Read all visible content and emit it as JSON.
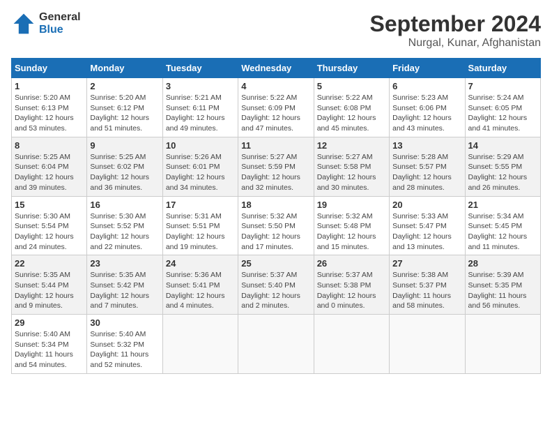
{
  "logo": {
    "line1": "General",
    "line2": "Blue"
  },
  "title": "September 2024",
  "location": "Nurgal, Kunar, Afghanistan",
  "weekdays": [
    "Sunday",
    "Monday",
    "Tuesday",
    "Wednesday",
    "Thursday",
    "Friday",
    "Saturday"
  ],
  "weeks": [
    [
      {
        "day": "1",
        "sunrise": "Sunrise: 5:20 AM",
        "sunset": "Sunset: 6:13 PM",
        "daylight": "Daylight: 12 hours and 53 minutes."
      },
      {
        "day": "2",
        "sunrise": "Sunrise: 5:20 AM",
        "sunset": "Sunset: 6:12 PM",
        "daylight": "Daylight: 12 hours and 51 minutes."
      },
      {
        "day": "3",
        "sunrise": "Sunrise: 5:21 AM",
        "sunset": "Sunset: 6:11 PM",
        "daylight": "Daylight: 12 hours and 49 minutes."
      },
      {
        "day": "4",
        "sunrise": "Sunrise: 5:22 AM",
        "sunset": "Sunset: 6:09 PM",
        "daylight": "Daylight: 12 hours and 47 minutes."
      },
      {
        "day": "5",
        "sunrise": "Sunrise: 5:22 AM",
        "sunset": "Sunset: 6:08 PM",
        "daylight": "Daylight: 12 hours and 45 minutes."
      },
      {
        "day": "6",
        "sunrise": "Sunrise: 5:23 AM",
        "sunset": "Sunset: 6:06 PM",
        "daylight": "Daylight: 12 hours and 43 minutes."
      },
      {
        "day": "7",
        "sunrise": "Sunrise: 5:24 AM",
        "sunset": "Sunset: 6:05 PM",
        "daylight": "Daylight: 12 hours and 41 minutes."
      }
    ],
    [
      {
        "day": "8",
        "sunrise": "Sunrise: 5:25 AM",
        "sunset": "Sunset: 6:04 PM",
        "daylight": "Daylight: 12 hours and 39 minutes."
      },
      {
        "day": "9",
        "sunrise": "Sunrise: 5:25 AM",
        "sunset": "Sunset: 6:02 PM",
        "daylight": "Daylight: 12 hours and 36 minutes."
      },
      {
        "day": "10",
        "sunrise": "Sunrise: 5:26 AM",
        "sunset": "Sunset: 6:01 PM",
        "daylight": "Daylight: 12 hours and 34 minutes."
      },
      {
        "day": "11",
        "sunrise": "Sunrise: 5:27 AM",
        "sunset": "Sunset: 5:59 PM",
        "daylight": "Daylight: 12 hours and 32 minutes."
      },
      {
        "day": "12",
        "sunrise": "Sunrise: 5:27 AM",
        "sunset": "Sunset: 5:58 PM",
        "daylight": "Daylight: 12 hours and 30 minutes."
      },
      {
        "day": "13",
        "sunrise": "Sunrise: 5:28 AM",
        "sunset": "Sunset: 5:57 PM",
        "daylight": "Daylight: 12 hours and 28 minutes."
      },
      {
        "day": "14",
        "sunrise": "Sunrise: 5:29 AM",
        "sunset": "Sunset: 5:55 PM",
        "daylight": "Daylight: 12 hours and 26 minutes."
      }
    ],
    [
      {
        "day": "15",
        "sunrise": "Sunrise: 5:30 AM",
        "sunset": "Sunset: 5:54 PM",
        "daylight": "Daylight: 12 hours and 24 minutes."
      },
      {
        "day": "16",
        "sunrise": "Sunrise: 5:30 AM",
        "sunset": "Sunset: 5:52 PM",
        "daylight": "Daylight: 12 hours and 22 minutes."
      },
      {
        "day": "17",
        "sunrise": "Sunrise: 5:31 AM",
        "sunset": "Sunset: 5:51 PM",
        "daylight": "Daylight: 12 hours and 19 minutes."
      },
      {
        "day": "18",
        "sunrise": "Sunrise: 5:32 AM",
        "sunset": "Sunset: 5:50 PM",
        "daylight": "Daylight: 12 hours and 17 minutes."
      },
      {
        "day": "19",
        "sunrise": "Sunrise: 5:32 AM",
        "sunset": "Sunset: 5:48 PM",
        "daylight": "Daylight: 12 hours and 15 minutes."
      },
      {
        "day": "20",
        "sunrise": "Sunrise: 5:33 AM",
        "sunset": "Sunset: 5:47 PM",
        "daylight": "Daylight: 12 hours and 13 minutes."
      },
      {
        "day": "21",
        "sunrise": "Sunrise: 5:34 AM",
        "sunset": "Sunset: 5:45 PM",
        "daylight": "Daylight: 12 hours and 11 minutes."
      }
    ],
    [
      {
        "day": "22",
        "sunrise": "Sunrise: 5:35 AM",
        "sunset": "Sunset: 5:44 PM",
        "daylight": "Daylight: 12 hours and 9 minutes."
      },
      {
        "day": "23",
        "sunrise": "Sunrise: 5:35 AM",
        "sunset": "Sunset: 5:42 PM",
        "daylight": "Daylight: 12 hours and 7 minutes."
      },
      {
        "day": "24",
        "sunrise": "Sunrise: 5:36 AM",
        "sunset": "Sunset: 5:41 PM",
        "daylight": "Daylight: 12 hours and 4 minutes."
      },
      {
        "day": "25",
        "sunrise": "Sunrise: 5:37 AM",
        "sunset": "Sunset: 5:40 PM",
        "daylight": "Daylight: 12 hours and 2 minutes."
      },
      {
        "day": "26",
        "sunrise": "Sunrise: 5:37 AM",
        "sunset": "Sunset: 5:38 PM",
        "daylight": "Daylight: 12 hours and 0 minutes."
      },
      {
        "day": "27",
        "sunrise": "Sunrise: 5:38 AM",
        "sunset": "Sunset: 5:37 PM",
        "daylight": "Daylight: 11 hours and 58 minutes."
      },
      {
        "day": "28",
        "sunrise": "Sunrise: 5:39 AM",
        "sunset": "Sunset: 5:35 PM",
        "daylight": "Daylight: 11 hours and 56 minutes."
      }
    ],
    [
      {
        "day": "29",
        "sunrise": "Sunrise: 5:40 AM",
        "sunset": "Sunset: 5:34 PM",
        "daylight": "Daylight: 11 hours and 54 minutes."
      },
      {
        "day": "30",
        "sunrise": "Sunrise: 5:40 AM",
        "sunset": "Sunset: 5:32 PM",
        "daylight": "Daylight: 11 hours and 52 minutes."
      },
      null,
      null,
      null,
      null,
      null
    ]
  ]
}
